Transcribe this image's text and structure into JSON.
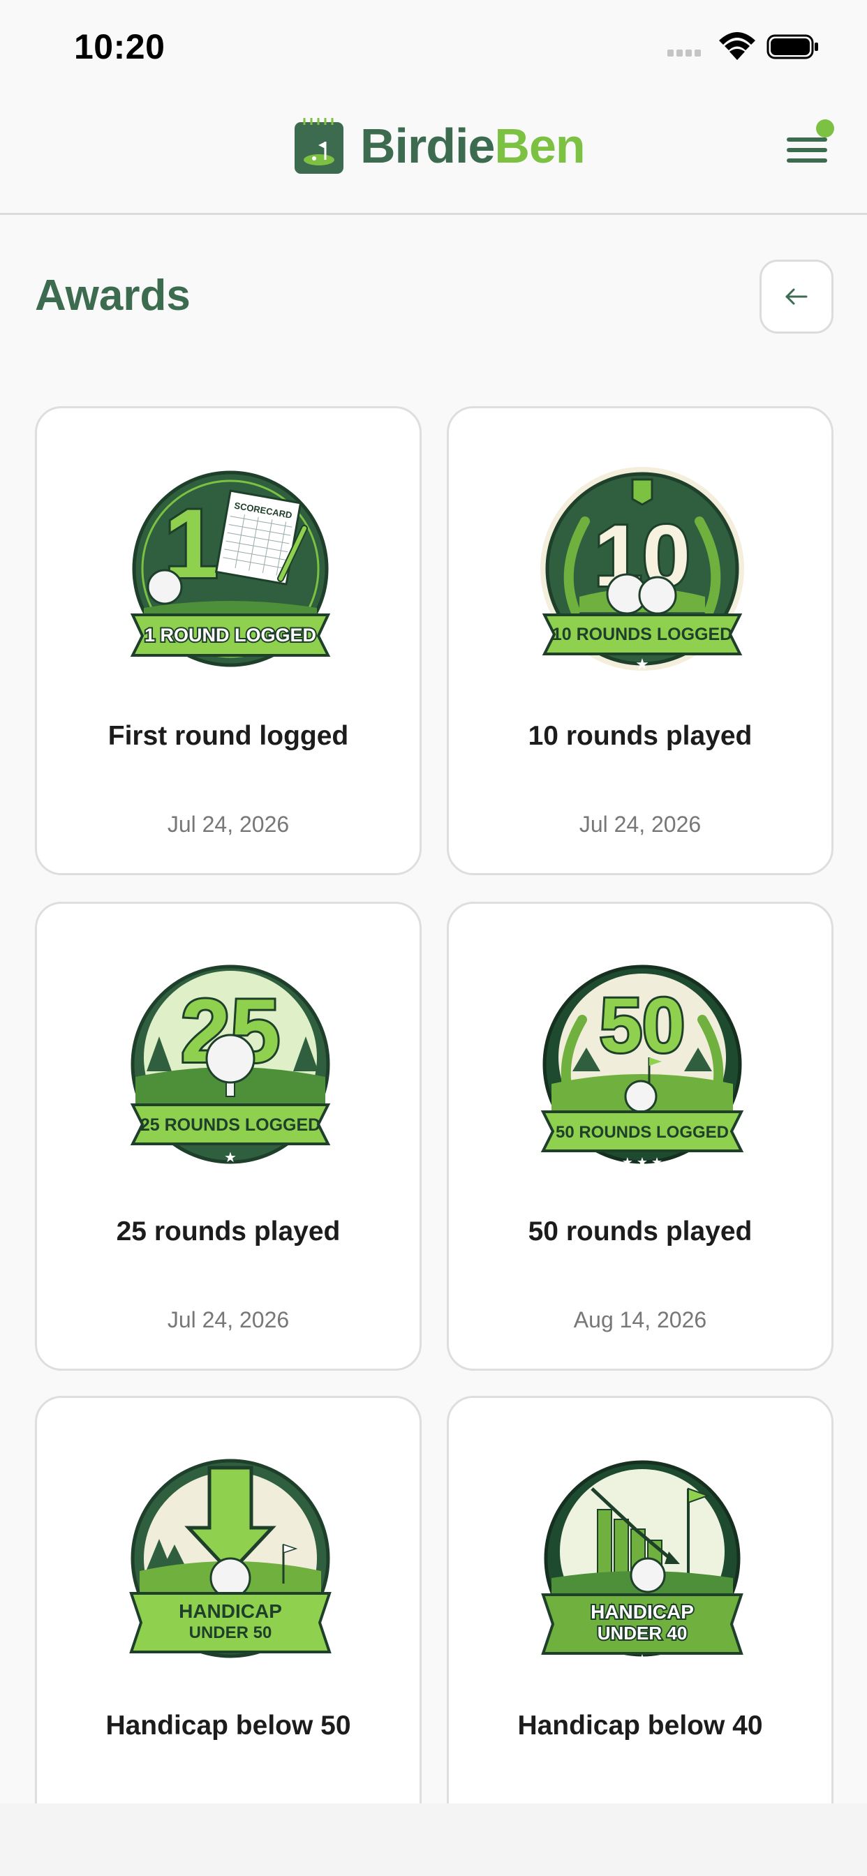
{
  "status_bar": {
    "time": "10:20"
  },
  "header": {
    "brand_part1": "Birdie",
    "brand_part2": "Ben",
    "colors": {
      "brand_dark": "#3c6b50",
      "brand_light": "#7dc143",
      "notification_dot": "#7dc143"
    }
  },
  "page": {
    "title": "Awards"
  },
  "awards": [
    {
      "title": "First round logged",
      "date": "Jul 24, 2026",
      "badge": {
        "number": "1",
        "banner": "1 ROUND LOGGED",
        "top": "SCORECARD"
      }
    },
    {
      "title": "10 rounds played",
      "date": "Jul 24, 2026",
      "badge": {
        "number": "10",
        "banner": "10 ROUNDS LOGGED"
      }
    },
    {
      "title": "25 rounds played",
      "date": "Jul 24, 2026",
      "badge": {
        "number": "25",
        "banner": "25 ROUNDS LOGGED"
      }
    },
    {
      "title": "50 rounds played",
      "date": "Aug 14, 2026",
      "badge": {
        "number": "50",
        "banner": "50 ROUNDS LOGGED"
      }
    },
    {
      "title": "Handicap below 50",
      "date": "",
      "badge": {
        "line1": "HANDICAP",
        "line2": "UNDER 50"
      }
    },
    {
      "title": "Handicap below 40",
      "date": "",
      "badge": {
        "line1": "HANDICAP",
        "line2": "UNDER 40"
      }
    }
  ]
}
